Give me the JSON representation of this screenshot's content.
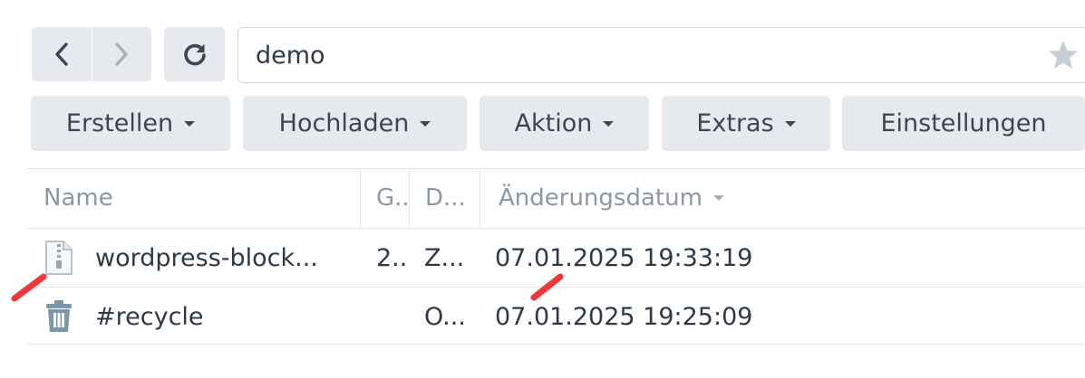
{
  "toolbar": {
    "path_value": "demo",
    "buttons": {
      "create": "Erstellen",
      "upload": "Hochladen",
      "action": "Aktion",
      "tools": "Extras",
      "settings": "Einstellungen"
    }
  },
  "table": {
    "columns": {
      "name": "Name",
      "size": "G..",
      "type": "D...",
      "modified": "Änderungsdatum"
    },
    "sort_column": "modified",
    "rows": [
      {
        "icon": "zip-file-icon",
        "name": "wordpress-block...",
        "size": "2..",
        "type": "Z...",
        "modified": "07.01.2025 19:33:19"
      },
      {
        "icon": "trash-icon",
        "name": "#recycle",
        "size": "",
        "type": "O...",
        "modified": "07.01.2025 19:25:09"
      }
    ]
  },
  "colors": {
    "button_bg": "#e6eaef",
    "header_text": "#8c98a3",
    "annotation_red": "#f0383a"
  }
}
